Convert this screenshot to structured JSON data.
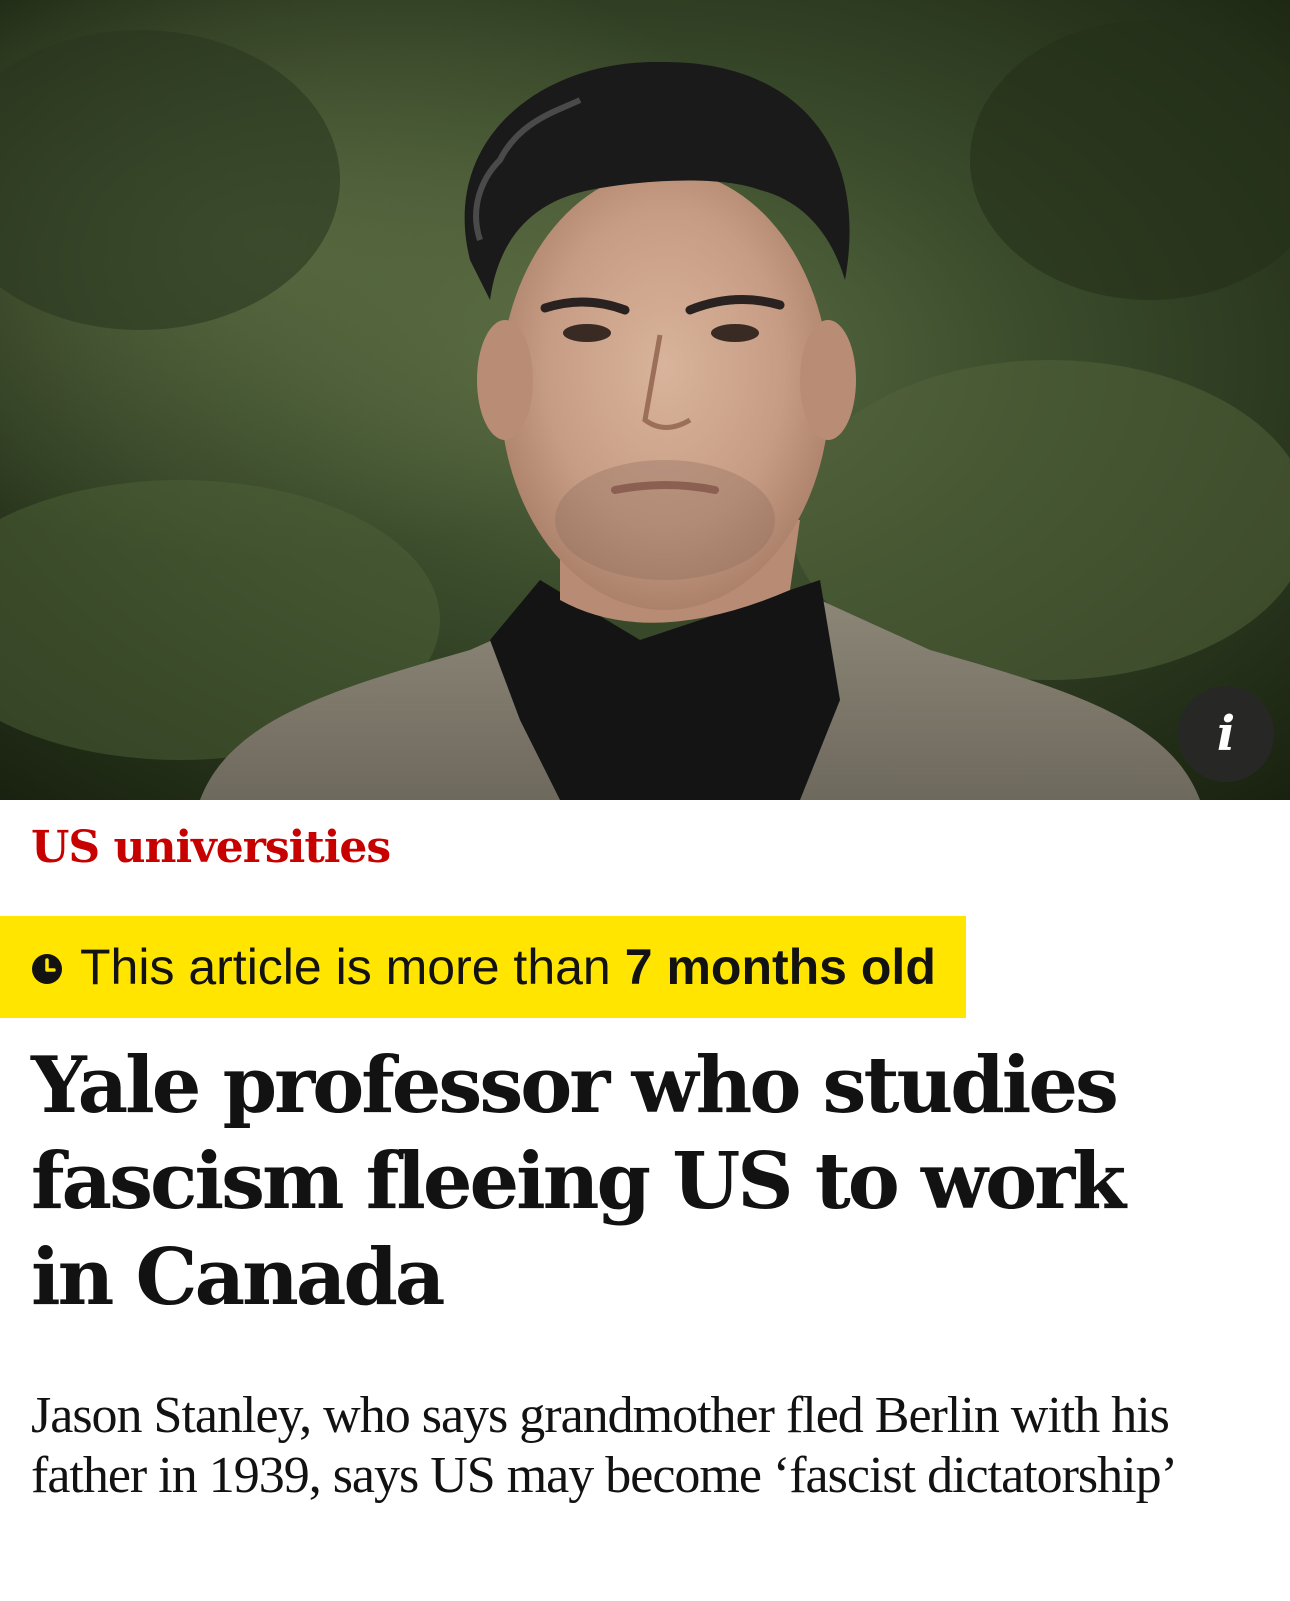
{
  "hero": {
    "info_icon": "info-icon",
    "info_symbol": "i"
  },
  "article": {
    "kicker": "US universities",
    "age_notice": {
      "icon": "clock-icon",
      "text": "This article is more than",
      "age": "7 months old"
    },
    "headline": "Yale professor who studies fascism fleeing US to work in Canada",
    "standfirst": "Jason Stanley, who says grandmother fled Berlin with his father in 1939, says US may become ‘fascist dictatorship’"
  },
  "colors": {
    "kicker": "#c70000",
    "banner": "#ffe500",
    "text": "#121212"
  }
}
